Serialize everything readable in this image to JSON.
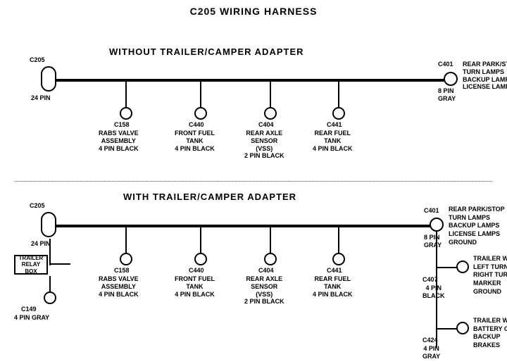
{
  "title": "C205 WIRING HARNESS",
  "section1": {
    "label": "WITHOUT TRAILER/CAMPER ADAPTER",
    "left_connector": {
      "id": "C205",
      "pins": "24 PIN"
    },
    "right_connector": {
      "id": "C401",
      "pins": "8 PIN",
      "color": "GRAY",
      "desc": "REAR PARK/STOP\nTURN LAMPS\nBACKUP LAMPS\nLICENSE LAMPS"
    },
    "connectors": [
      {
        "id": "C158",
        "desc": "RABS VALVE\nASSEMBLY\n4 PIN BLACK"
      },
      {
        "id": "C440",
        "desc": "FRONT FUEL\nTANK\n4 PIN BLACK"
      },
      {
        "id": "C404",
        "desc": "REAR AXLE\nSENSOR\n(VSS)\n2 PIN BLACK"
      },
      {
        "id": "C441",
        "desc": "REAR FUEL\nTANK\n4 PIN BLACK"
      }
    ]
  },
  "section2": {
    "label": "WITH TRAILER/CAMPER ADAPTER",
    "left_connector": {
      "id": "C205",
      "pins": "24 PIN"
    },
    "right_connector": {
      "id": "C401",
      "pins": "8 PIN",
      "color": "GRAY",
      "desc": "REAR PARK/STOP\nTURN LAMPS\nBACKUP LAMPS\nLICENSE LAMPS\nGROUND"
    },
    "extra_left": {
      "id": "C149",
      "pins": "4 PIN GRAY",
      "box": "TRAILER\nRELAY\nBOX"
    },
    "connectors": [
      {
        "id": "C158",
        "desc": "RABS VALVE\nASSEMBLY\n4 PIN BLACK"
      },
      {
        "id": "C440",
        "desc": "FRONT FUEL\nTANK\n4 PIN BLACK"
      },
      {
        "id": "C404",
        "desc": "REAR AXLE\nSENSOR\n(VSS)\n2 PIN BLACK"
      },
      {
        "id": "C441",
        "desc": "REAR FUEL\nTANK\n4 PIN BLACK"
      }
    ],
    "right_branches": [
      {
        "id": "C407",
        "pins": "4 PIN\nBLACK",
        "desc": "TRAILER WIRES\nLEFT TURN\nRIGHT TURN\nMARKER\nGROUND"
      },
      {
        "id": "C424",
        "pins": "4 PIN\nGRAY",
        "desc": "TRAILER WIRES\nBATTERY CHARGE\nBACKUP\nBRAKES"
      }
    ]
  }
}
